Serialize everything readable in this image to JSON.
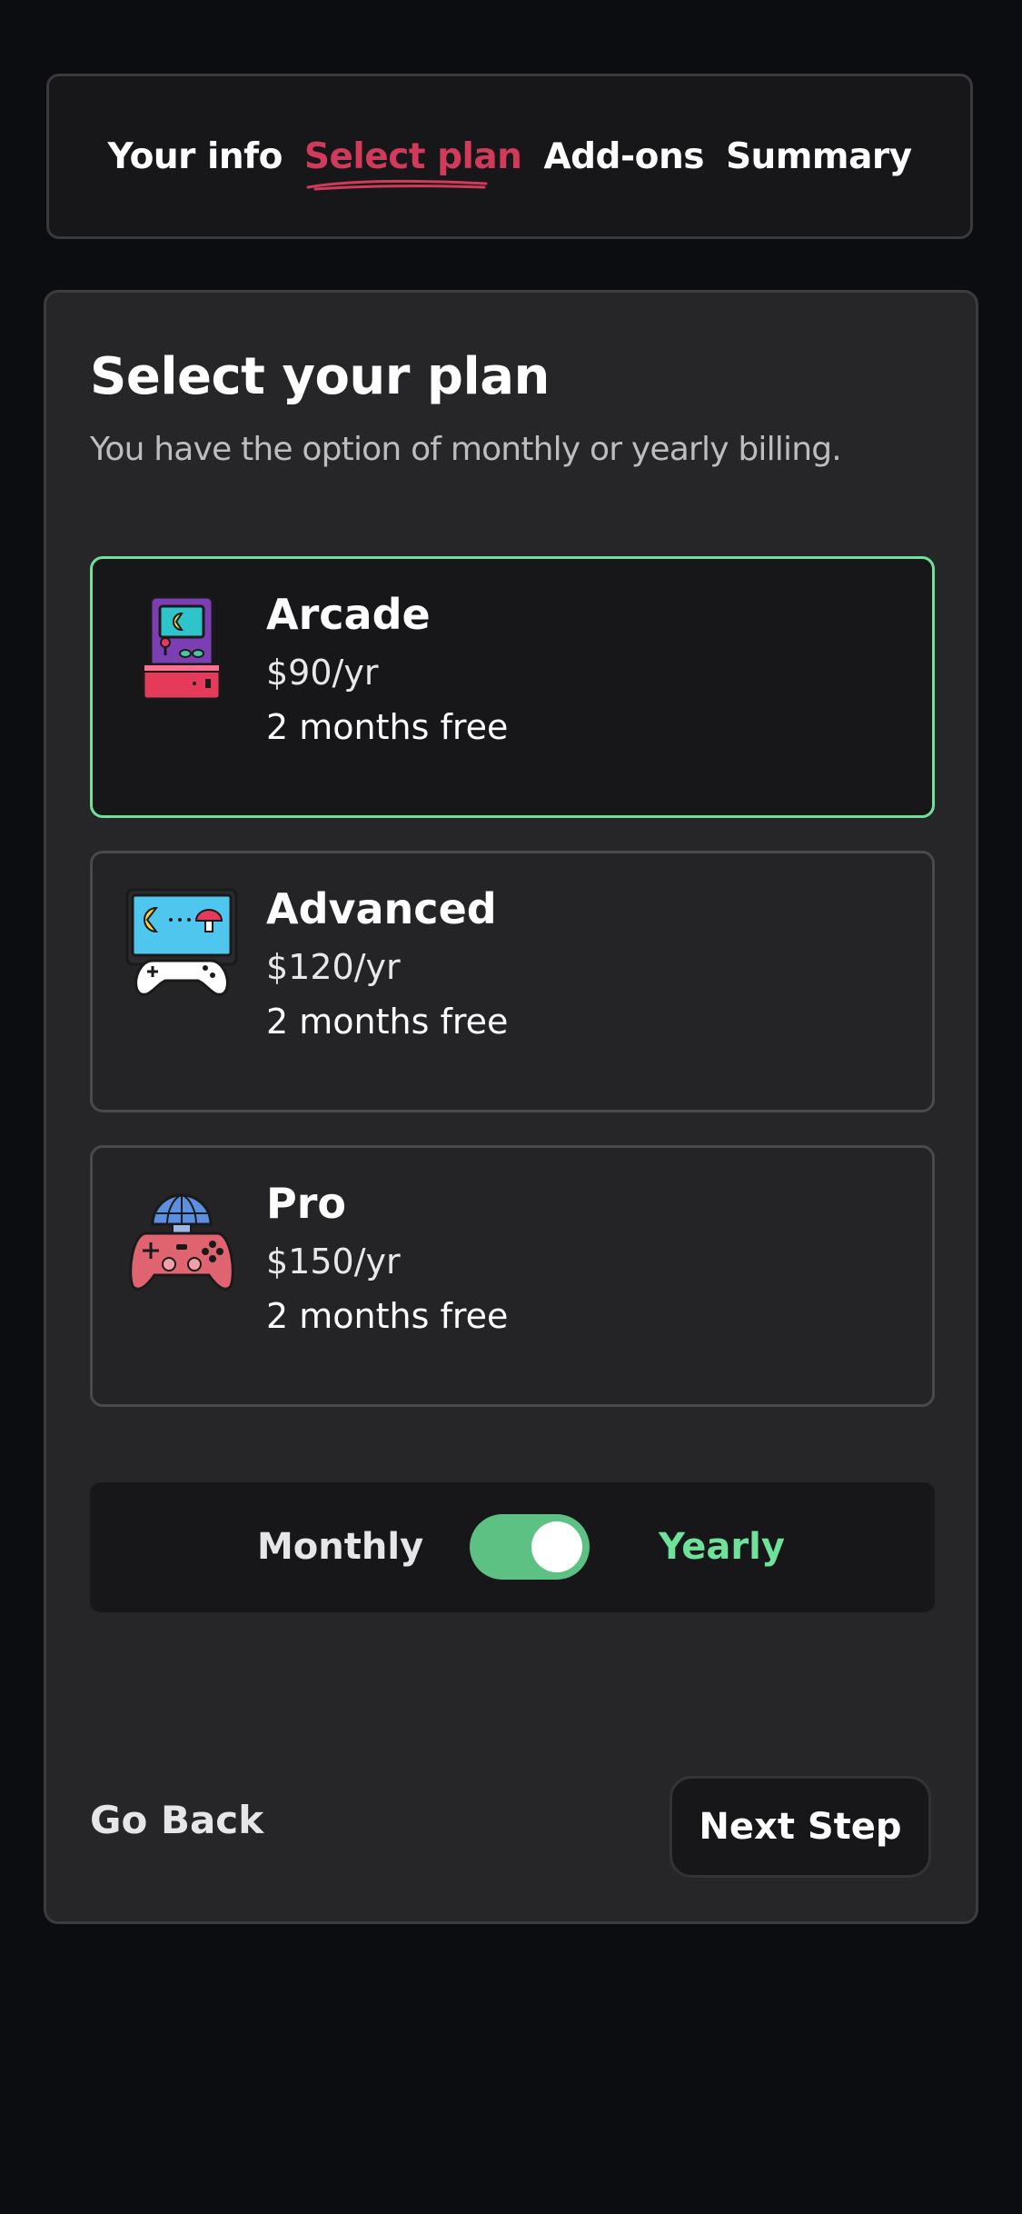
{
  "steps": [
    {
      "label": "Your info",
      "active": false
    },
    {
      "label": "Select plan",
      "active": true
    },
    {
      "label": "Add-ons",
      "active": false
    },
    {
      "label": "Summary",
      "active": false
    }
  ],
  "header": {
    "title": "Select your plan",
    "subtitle": "You have the option of monthly or yearly billing."
  },
  "plans": [
    {
      "name": "Arcade",
      "price": "$90/yr",
      "promo": "2 months free",
      "icon": "arcade-icon",
      "selected": true
    },
    {
      "name": "Advanced",
      "price": "$120/yr",
      "promo": "2 months free",
      "icon": "advanced-icon",
      "selected": false
    },
    {
      "name": "Pro",
      "price": "$150/yr",
      "promo": "2 months free",
      "icon": "pro-icon",
      "selected": false
    }
  ],
  "billing": {
    "monthly_label": "Monthly",
    "yearly_label": "Yearly",
    "selected": "yearly"
  },
  "footer": {
    "back_label": "Go Back",
    "next_label": "Next Step"
  },
  "colors": {
    "background": "#0c0d10",
    "card": "#262628",
    "accent_active_step": "#d13a5a",
    "accent_selected": "#6ee29a",
    "toggle_on": "#5ec184"
  }
}
